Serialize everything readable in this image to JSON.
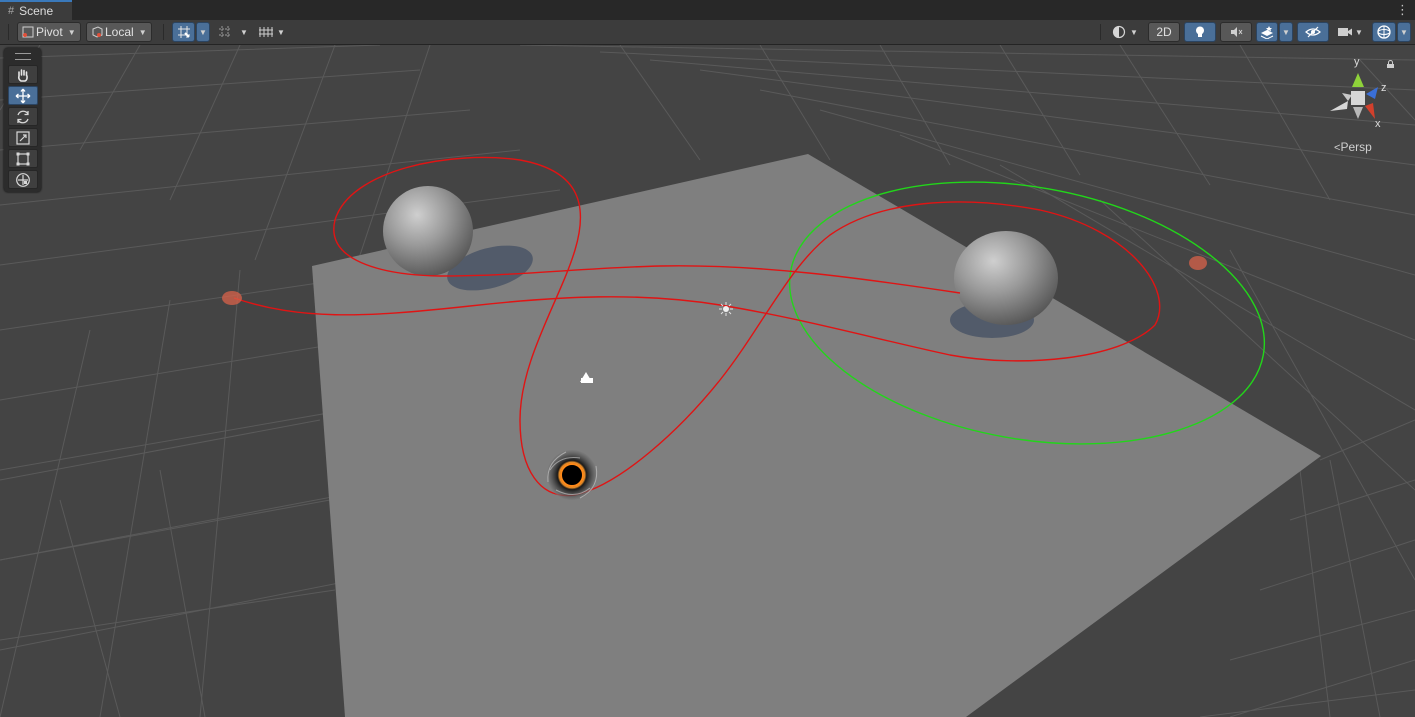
{
  "tab": {
    "title": "Scene",
    "icon": "grid-icon"
  },
  "toolbar": {
    "pivot_label": "Pivot",
    "local_label": "Local",
    "mode_2d_label": "2D"
  },
  "gizmo": {
    "persp_label": "Persp",
    "axis_y": "y",
    "axis_z": "z",
    "axis_x": "x"
  },
  "colors": {
    "accent": "#4a6f98",
    "orbit_red": "#e01414",
    "orbit_green": "#22d61a",
    "axis_x": "#d2402c",
    "axis_y": "#8fd23a",
    "axis_z": "#3a6fd8"
  },
  "tools": [
    "hand-tool",
    "move-tool",
    "rotate-tool",
    "scale-tool",
    "rect-tool",
    "transform-tool"
  ],
  "active_tool": "move-tool"
}
